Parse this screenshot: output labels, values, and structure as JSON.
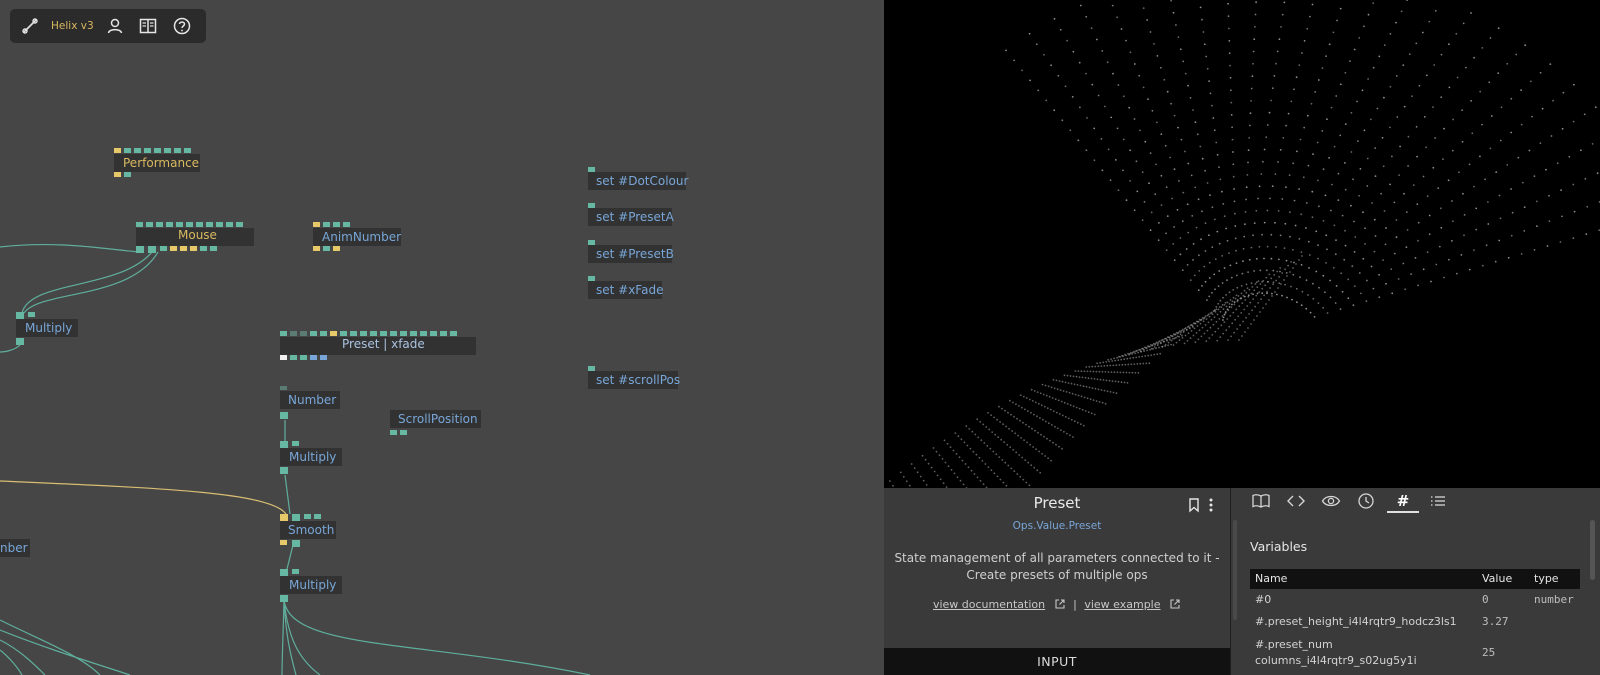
{
  "toolbar": {
    "title": "Helix v3",
    "icons": [
      "patch-link-icon",
      "user-icon",
      "book-icon",
      "help-icon"
    ]
  },
  "nodes": {
    "performance": "Performance",
    "mouse": "Mouse",
    "anim_number": "AnimNumber",
    "multiply_1": "Multiply",
    "preset_xfade": "Preset | xfade",
    "number": "Number",
    "scroll_position": "ScrollPosition",
    "multiply_2": "Multiply",
    "smooth": "Smooth",
    "multiply_3": "Multiply",
    "number_partial": "nber",
    "set_dot_colour": "set #DotColour",
    "set_preset_a": "set #PresetA",
    "set_preset_b": "set #PresetB",
    "set_xfade": "set #xFade",
    "set_scroll_pos": "set #scrollPos"
  },
  "op_panel": {
    "title": "Preset",
    "path": "Ops.Value.Preset",
    "description_line1": "State management of all parameters connected to it -",
    "description_line2": "Create presets of multiple ops",
    "doc_link": "view documentation",
    "separator": "|",
    "example_link": "view example",
    "input_tab": "INPUT"
  },
  "right_tabs": [
    "book-icon",
    "code-icon",
    "eye-icon",
    "clock-icon",
    "hash-icon",
    "list-icon"
  ],
  "hash_glyph": "#",
  "variables": {
    "title": "Variables",
    "headers": {
      "name": "Name",
      "value": "Value",
      "type": "type"
    },
    "rows": [
      {
        "name": "#0",
        "value": "0",
        "type": "number"
      },
      {
        "name": "#.preset_height_i4l4rqtr9_hodcz3ls1",
        "value": "3.27",
        "type": ""
      },
      {
        "name_line1": "#.preset_num",
        "name_line2": "columns_i4l4rqtr9_s02ug5y1i",
        "value": "25",
        "type": ""
      }
    ]
  },
  "colors": {
    "canvas": "#464646",
    "port_teal": "#67b8a2",
    "port_yellow": "#e8c96a",
    "value_label": "#78a6d8",
    "op_label": "#d8b960",
    "wire_teal": "#5fae9c",
    "wire_yellow": "#d8be72"
  }
}
